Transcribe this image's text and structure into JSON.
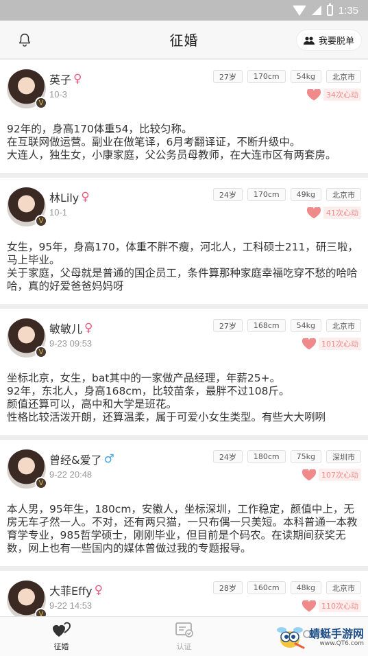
{
  "status_bar": {
    "time": "1:35"
  },
  "nav": {
    "title": "征婚",
    "escape_label": "我要脱单"
  },
  "colors": {
    "accent_pink": "#e85d7b",
    "heart": "#f08a8a",
    "male_blue": "#4aa3df"
  },
  "posts": [
    {
      "name": "英子",
      "gender": "♀",
      "date": "10-3",
      "tags": [
        "27岁",
        "170cm",
        "54kg",
        "北京市"
      ],
      "likes": "34次心动",
      "desc": "92年的，身高170体重54，比较匀称。\n在互联网做运营。副业在做笔译，6月考翻译证，不断升级中。\n大连人，独生女，小康家庭，父公务员母教师，在大连市区有两套房。"
    },
    {
      "name": "林Lily",
      "gender": "♀",
      "date": "10-1",
      "tags": [
        "24岁",
        "170cm",
        "49kg",
        "北京市"
      ],
      "likes": "41次心动",
      "desc": "女生，95年，身高170，体重不胖不瘦，河北人，工科硕士211，研三啦，马上毕业。\n关于家庭，父母就是普通的国企员工，条件算那种家庭幸福吃穿不愁的哈哈哈，真的好爱爸爸妈妈呀"
    },
    {
      "name": "敏敏儿",
      "gender": "♀",
      "date": "9-23 09:53",
      "tags": [
        "27岁",
        "168cm",
        "54kg",
        "北京市"
      ],
      "likes": "101次心动",
      "desc": "坐标北京，女生，bat其中的一家做产品经理，年薪25+。\n92年，东北人，身高168cm，比较苗条，最胖不过108斤。\n颜值还算可以，高中和大学是班花。\n性格比较活泼开朗，还算温柔，属于可爱小女生类型。有些大大咧咧"
    },
    {
      "name": "曾经&爱了",
      "gender": "♂",
      "date": "9-22 20:48",
      "tags": [
        "24岁",
        "180cm",
        "75kg",
        "深圳市"
      ],
      "likes": "107次心动",
      "desc": "本人男，95年生，180cm，安徽人，坐标深圳，工作稳定，颜值中上，无房无车孑然一人。不对，还有两只猫，一只布偶一只美短。本科普通一本教育学专业，985哲学硕士，刚刚毕业，但目前是个码农。在读期间获奖无数，网上也有一些国内的媒体曾做过我的专题报导。"
    },
    {
      "name": "大菲Effy",
      "gender": "♀",
      "date": "9-22 14:53",
      "tags": [
        "28岁",
        "160cm",
        "48kg",
        "北京市"
      ],
      "likes": "110次心动",
      "desc": ""
    }
  ],
  "tabbar": {
    "tab1": "征婚",
    "tab2": "认证"
  },
  "watermark": {
    "name": "蜻蜓手游网",
    "url": "www.QT6.com"
  }
}
